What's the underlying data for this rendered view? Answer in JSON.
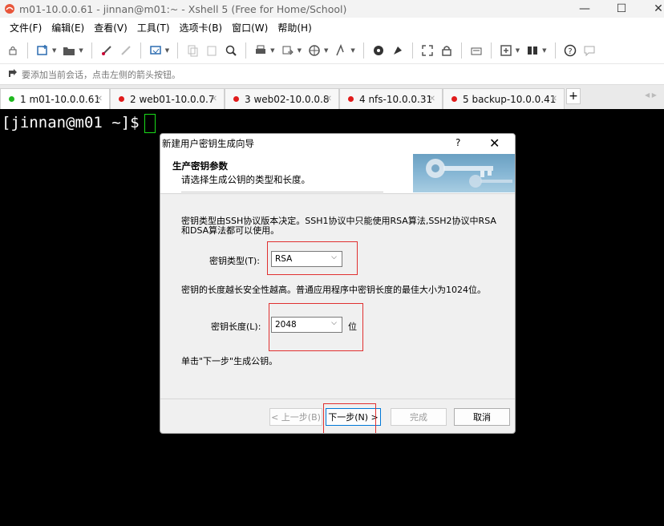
{
  "window": {
    "title": "m01-10.0.0.61 - jinnan@m01:~ - Xshell 5 (Free for Home/School)",
    "controls": {
      "minimize": "—",
      "maximize": "☐",
      "close": "✕"
    }
  },
  "menu": [
    {
      "label": "文件(F)"
    },
    {
      "label": "编辑(E)"
    },
    {
      "label": "查看(V)"
    },
    {
      "label": "工具(T)"
    },
    {
      "label": "选项卡(B)"
    },
    {
      "label": "窗口(W)"
    },
    {
      "label": "帮助(H)"
    }
  ],
  "hint_bar": {
    "text": "要添加当前会话，点击左侧的箭头按钮。"
  },
  "tabs": [
    {
      "label": "1 m01-10.0.0.61",
      "status_color": "#1fb81f",
      "active": true
    },
    {
      "label": "2 web01-10.0.0.7",
      "status_color": "#e01b1b",
      "active": false
    },
    {
      "label": "3 web02-10.0.0.8",
      "status_color": "#e01b1b",
      "active": false
    },
    {
      "label": "4 nfs-10.0.0.31",
      "status_color": "#e01b1b",
      "active": false
    },
    {
      "label": "5 backup-10.0.0.41",
      "status_color": "#e01b1b",
      "active": false
    }
  ],
  "tab_add_label": "+",
  "terminal": {
    "prompt": "[jinnan@m01 ~]$ "
  },
  "dialog": {
    "title": "新建用户密钥生成向导",
    "help": "?",
    "close": "✕",
    "header_title": "生产密钥参数",
    "header_subtitle": "请选择生成公钥的类型和长度。",
    "para_key_type": "密钥类型由SSH协议版本决定。SSH1协议中只能使用RSA算法,SSH2协议中RSA和DSA算法都可以使用。",
    "key_type_label": "密钥类型(T):",
    "key_type_value": "RSA",
    "para_key_length": "密钥的长度越长安全性越高。普通应用程序中密钥长度的最佳大小为1024位。",
    "key_length_label": "密钥长度(L):",
    "key_length_value": "2048",
    "key_length_unit": "位",
    "para_next": "单击\"下一步\"生成公钥。",
    "buttons": {
      "back": "< 上一步(B)",
      "next": "下一步(N) >",
      "finish": "完成",
      "cancel": "取消"
    }
  },
  "colors": {
    "highlight": "#e03030",
    "accent": "#0078d7",
    "cursor": "#1adb1a"
  }
}
